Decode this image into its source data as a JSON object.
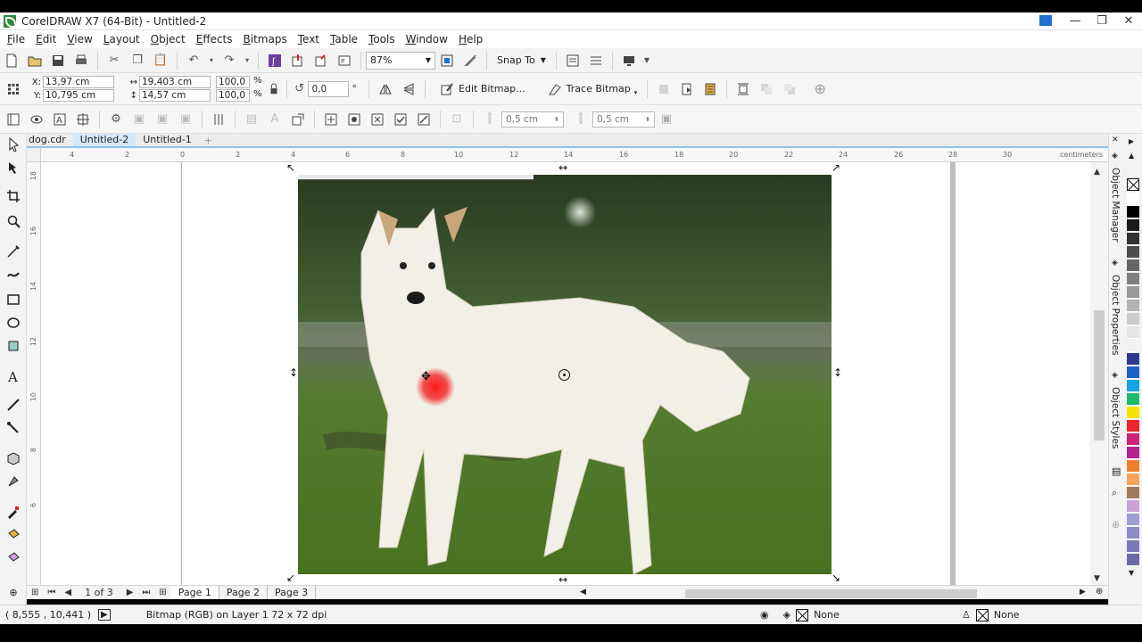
{
  "window": {
    "title": "CorelDRAW X7 (64-Bit) - Untitled-2"
  },
  "menu": [
    "File",
    "Edit",
    "View",
    "Layout",
    "Object",
    "Effects",
    "Bitmaps",
    "Text",
    "Table",
    "Tools",
    "Window",
    "Help"
  ],
  "standard_toolbar": {
    "zoom_level": "87%",
    "snap_to_label": "Snap To"
  },
  "property_bar": {
    "x_label": "X:",
    "x_value": "13,97 cm",
    "y_label": "Y:",
    "y_value": "10,795 cm",
    "width_value": "19,403 cm",
    "height_value": "14,57 cm",
    "scale_x": "100,0",
    "scale_y": "100,0",
    "percent_sign": "%",
    "rotation": "0,0",
    "degree_sign": "°",
    "edit_bitmap_label": "Edit Bitmap...",
    "trace_bitmap_label": "Trace Bitmap"
  },
  "toolbar3": {
    "offset_h": "0,5 cm",
    "offset_v": "0,5 cm"
  },
  "document_tabs": [
    {
      "label": "dog.cdr",
      "active": false
    },
    {
      "label": "Untitled-2",
      "active": true
    },
    {
      "label": "Untitled-1",
      "active": false
    }
  ],
  "ruler": {
    "unit": "centimeters",
    "h_labels": [
      "4",
      "2",
      "0",
      "2",
      "4",
      "6",
      "8",
      "10",
      "12",
      "14",
      "16",
      "18",
      "20",
      "22",
      "24",
      "26",
      "28",
      "30"
    ],
    "v_labels": [
      "18",
      "16",
      "14",
      "12",
      "10",
      "8",
      "6"
    ]
  },
  "page_nav": {
    "counter": "1 of 3",
    "pages": [
      "Page 1",
      "Page 2",
      "Page 3"
    ]
  },
  "dockers": [
    "Object Manager",
    "Object Properties",
    "Object Styles"
  ],
  "palette": [
    "#ffffff",
    "#000000",
    "#1a1a1a",
    "#333333",
    "#4d4d4d",
    "#666666",
    "#808080",
    "#999999",
    "#b3b3b3",
    "#cccccc",
    "#e6e6e6",
    "#f2f2f2",
    "#2b3a8f",
    "#1f5fc9",
    "#12a3e0",
    "#1fb86f",
    "#f4e400",
    "#e8262b",
    "#d0217a",
    "#b3228f",
    "#f07f2b",
    "#f3a55c",
    "#a07a5a",
    "#c9a0d8",
    "#9f9fd6",
    "#8c8cc8",
    "#7a7ab8",
    "#6a6aa8"
  ],
  "status": {
    "coords": "( 8,555 , 10,441 )",
    "description": "Bitmap (RGB) on Layer 1 72 x 72 dpi",
    "fill_label": "None",
    "stroke_label": "None"
  }
}
